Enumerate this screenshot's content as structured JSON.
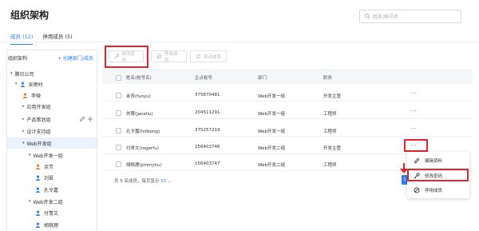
{
  "page": {
    "title": "组织架构"
  },
  "search": {
    "placeholder": "姓名/帐号名"
  },
  "tabs": [
    {
      "label": "成员 (12)"
    },
    {
      "label": "停用成员 (5)"
    }
  ],
  "sidebar": {
    "header": "组织架构",
    "create_label": "+ 创建部门/成员",
    "tree": [
      {
        "label": "腾讯公司"
      },
      {
        "label": "吴雨村"
      },
      {
        "label": "李微"
      },
      {
        "label": "应用开发组"
      },
      {
        "label": "产品策划组"
      },
      {
        "label": "设计支持组"
      },
      {
        "label": "Web开发组"
      },
      {
        "label": "Web开发一组"
      },
      {
        "label": "余芳"
      },
      {
        "label": "刘翠"
      },
      {
        "label": "孔令嘉"
      },
      {
        "label": "Web开发二组"
      },
      {
        "label": "付青文"
      },
      {
        "label": "胡桃理"
      }
    ]
  },
  "toolbar": {
    "change_password": "修改密码",
    "disable_member": "停用成员",
    "move_member": "移动成员"
  },
  "table": {
    "headers": [
      "姓名(帐号名)",
      "企点帐号",
      "部门",
      "职务"
    ],
    "rows": [
      [
        "余芳(funyu)",
        "375870481",
        "Web开发一组",
        "开发主管"
      ],
      [
        "刘翠(janeliu)",
        "204511291",
        "Web开发一组",
        "工程师"
      ],
      [
        "孔令嘉(hillkong)",
        "375257219",
        "Web开发一组",
        "工程师"
      ],
      [
        "付青文(rogerfu)",
        "156403746",
        "Web开发二组",
        "开发主管"
      ],
      [
        "胡桃理(jimmyhu)",
        "156403747",
        "Web开发二组",
        "工程师"
      ]
    ],
    "more": "···"
  },
  "footer": {
    "prefix": "共 5 名成员，每页显示",
    "page_size": "15",
    "arrow": "⌄",
    "current_page": "1"
  },
  "context_menu": {
    "items": [
      {
        "label": "编辑资料"
      },
      {
        "label": "修改密码"
      },
      {
        "label": "停用成员"
      }
    ]
  },
  "colors": {
    "accent": "#2d7df6",
    "highlight": "#e4262c",
    "selected_bg": "#eaf2ff"
  }
}
